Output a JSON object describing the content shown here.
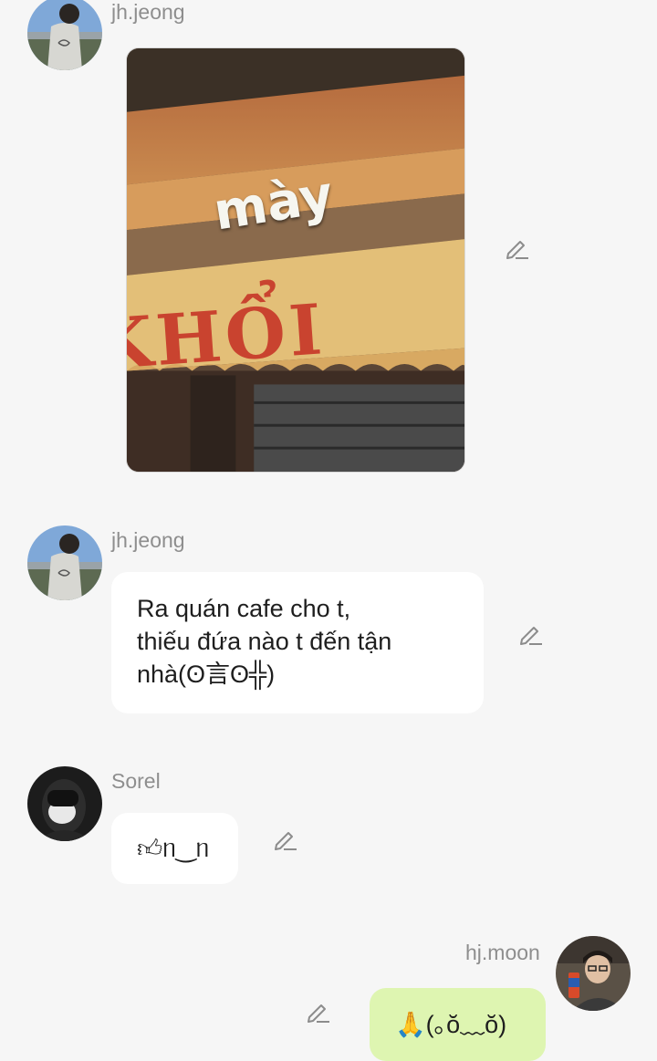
{
  "messages": [
    {
      "sender": "jh.jeong",
      "type": "image",
      "image_text": "mày",
      "sign_text": "KHỔI"
    },
    {
      "sender": "jh.jeong",
      "type": "text",
      "lines": [
        "Ra quán cafe cho t,",
        "thiếu đứa nào t đến tận",
        "nhà(ʘ言ʘ╬)"
      ]
    },
    {
      "sender": "Sorel",
      "type": "text",
      "lines": [
        "👍︎ᥒ‿ᥒ"
      ]
    },
    {
      "sender": "hj.moon",
      "type": "text",
      "own": true,
      "lines": [
        "🙏(｡ŏ﹏ŏ)"
      ]
    }
  ],
  "colors": {
    "background": "#f6f6f6",
    "bubble_incoming": "#ffffff",
    "bubble_outgoing": "#def5b1",
    "sender_name": "#8e8e8e"
  },
  "icons": [
    "edit-pencil-icon"
  ]
}
